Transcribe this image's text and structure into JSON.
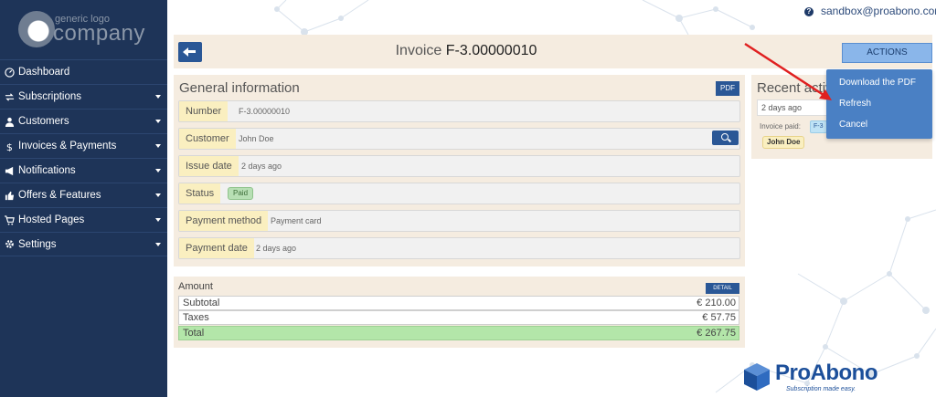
{
  "logo": {
    "small_text": "generic logo",
    "big_text": "company"
  },
  "sidebar": {
    "items": [
      {
        "label": "Dashboard",
        "icon": "dashboard-icon",
        "has_caret": false
      },
      {
        "label": "Subscriptions",
        "icon": "subscriptions-icon",
        "has_caret": true
      },
      {
        "label": "Customers",
        "icon": "user-icon",
        "has_caret": true
      },
      {
        "label": "Invoices & Payments",
        "icon": "dollar-icon",
        "has_caret": true
      },
      {
        "label": "Notifications",
        "icon": "megaphone-icon",
        "has_caret": true
      },
      {
        "label": "Offers & Features",
        "icon": "thumbs-up-icon",
        "has_caret": true
      },
      {
        "label": "Hosted Pages",
        "icon": "cart-icon",
        "has_caret": true
      },
      {
        "label": "Settings",
        "icon": "gear-icon",
        "has_caret": true
      }
    ]
  },
  "topbar": {
    "user_email": "sandbox@proabono.com"
  },
  "header": {
    "title_prefix": "Invoice",
    "invoice_number": "F-3.00000010",
    "actions_label": "ACTIONS"
  },
  "actions_menu": {
    "items": [
      "Download the PDF",
      "Refresh",
      "Cancel"
    ]
  },
  "general": {
    "title": "General information",
    "pdf_label": "PDF",
    "fields": {
      "number": {
        "label": "Number",
        "value": "F-3.00000010"
      },
      "customer": {
        "label": "Customer",
        "value": "John Doe"
      },
      "issue_date": {
        "label": "Issue date",
        "value": "2 days ago"
      },
      "status": {
        "label": "Status",
        "value": "Paid"
      },
      "payment_method": {
        "label": "Payment method",
        "value": "Payment card"
      },
      "payment_date": {
        "label": "Payment date",
        "value": "2 days ago"
      }
    }
  },
  "amount": {
    "title": "Amount",
    "detail_label": "DETAIL",
    "rows": [
      {
        "label": "Subtotal",
        "value": "€ 210.00"
      },
      {
        "label": "Taxes",
        "value": "€ 57.75"
      },
      {
        "label": "Total",
        "value": "€ 267.75"
      }
    ]
  },
  "recent": {
    "title": "Recent activity",
    "filter_value": "2 days ago",
    "entry_text": "Invoice paid:",
    "entry_invoice": "F-3",
    "entry_customer": "John Doe"
  },
  "brand": {
    "name": "ProAbono",
    "tagline": "Subscription made easy."
  },
  "colors": {
    "sidebar": "#1e3458",
    "accent": "#2a5796",
    "panel": "#f5ece0",
    "label_bg": "#faefc0",
    "total_bg": "#b3e6a9",
    "dropdown": "#4a80c4",
    "arrow": "#e02020"
  }
}
